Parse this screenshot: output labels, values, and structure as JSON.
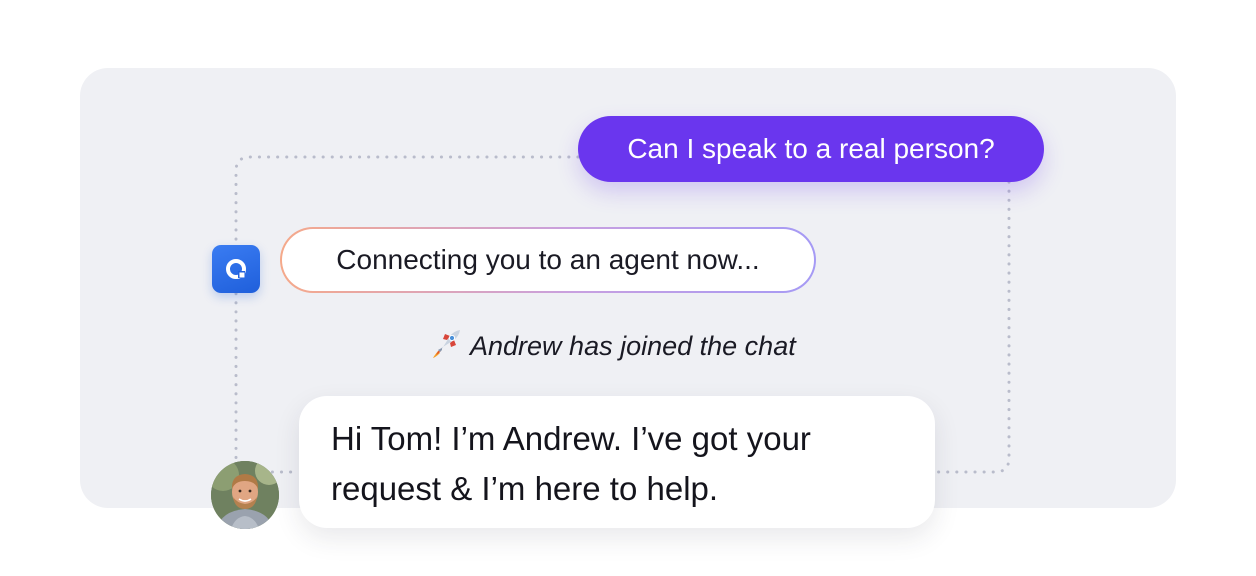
{
  "chat": {
    "user_message": "Can I speak to a real person?",
    "bot_message": "Connecting you to an agent now...",
    "system_note": "Andrew has joined the chat",
    "system_note_icon": "rocket-icon",
    "agent_message": "Hi Tom! I’m Andrew. I’ve got your request & I’m here to help."
  },
  "colors": {
    "panel_background": "#eff0f4",
    "user_bubble": "#6a36ee",
    "bot_avatar": "#2a6be6",
    "connector_dots": "#b9bccb"
  },
  "icons": {
    "bot_avatar": "bot-logo-icon",
    "agent_avatar": "agent-photo-avatar"
  }
}
